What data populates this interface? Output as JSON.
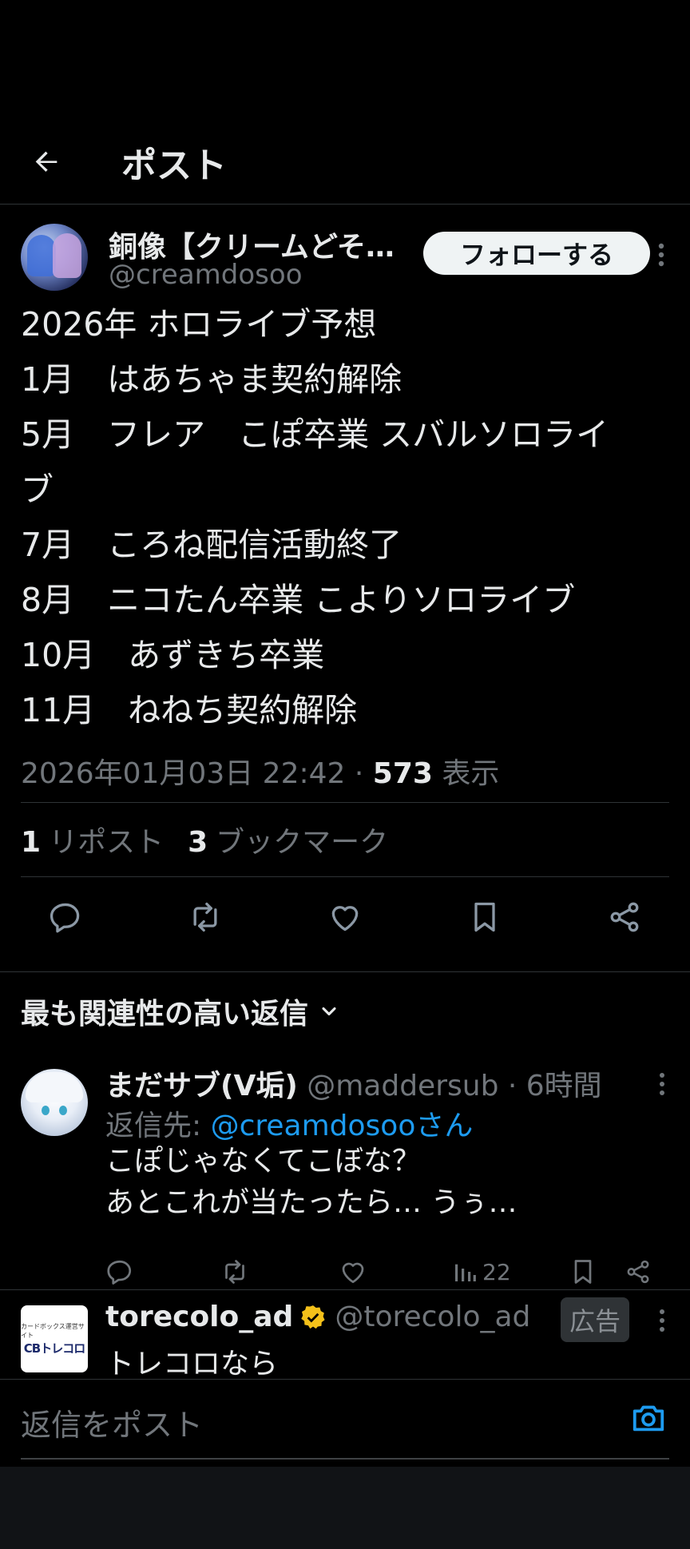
{
  "header": {
    "title": "ポスト"
  },
  "post": {
    "author_name": "銅像【クリームどそ…",
    "author_handle": "@creamdosoo",
    "follow_label": "フォローする",
    "lines": [
      "2026年 ホロライブ予想",
      "1月　はあちゃま契約解除",
      "5月　フレア　こぽ卒業 スバルソロライ",
      "ブ",
      "7月　ころね配信活動終了",
      "8月　ニコたん卒業 こよりソロライブ",
      "10月　あずきち卒業",
      "11月　ねねち契約解除"
    ],
    "timestamp": "2026年01月03日 22:42 · ",
    "views_count": "573",
    "views_label": " 表示",
    "reposts_count": "1",
    "reposts_label": "リポスト",
    "bookmarks_count": "3",
    "bookmarks_label": "ブックマーク"
  },
  "replies_section": {
    "title": "最も関連性の高い返信"
  },
  "reply": {
    "name": "まだサブ(V垢)",
    "handle_time": " @maddersub · 6時間",
    "reply_to_prefix": "返信先: ",
    "reply_to_mention": "@creamdosooさん",
    "lines": [
      "こぽじゃなくてこぼな？",
      "あとこれが当たったら… うぅ…"
    ],
    "views": "22"
  },
  "ad": {
    "name": "torecolo_ad",
    "handle": "@torecolo_ad",
    "badge": "広告",
    "text": "トレコロなら",
    "logo_small": "カードボックス運営サイト",
    "logo_big": "CBトレコロ"
  },
  "composer": {
    "placeholder": "返信をポスト"
  },
  "colors": {
    "accent": "#1d9bf0",
    "verified": "#f4c11a",
    "background": "#000000",
    "muted": "#71767b"
  }
}
